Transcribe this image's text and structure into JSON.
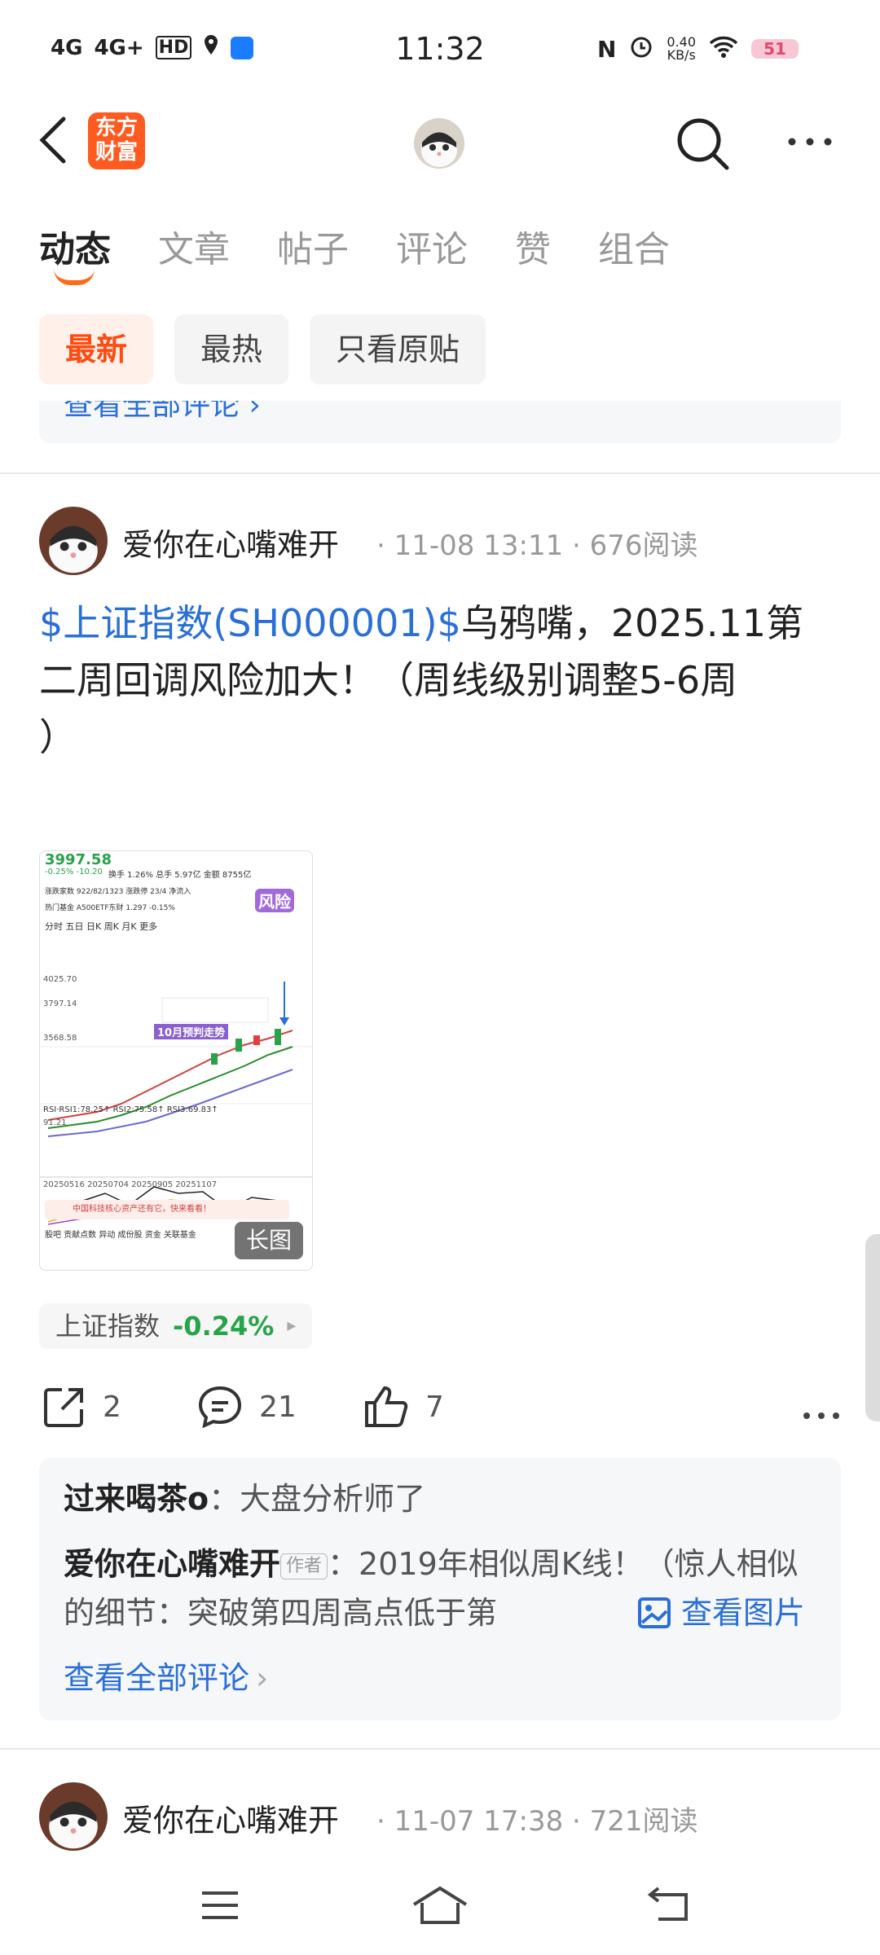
{
  "status_bar": {
    "time": "11:32",
    "signal_1": "4G",
    "signal_2": "4G+",
    "hd": "HD",
    "net_speed": "0.40",
    "net_unit": "KB/s",
    "battery": "51"
  },
  "header": {
    "logo_line1": "东方",
    "logo_line2": "财富"
  },
  "tabs": [
    {
      "label": "动态",
      "active": true
    },
    {
      "label": "文章"
    },
    {
      "label": "帖子"
    },
    {
      "label": "评论"
    },
    {
      "label": "赞"
    },
    {
      "label": "组合"
    }
  ],
  "filters": [
    {
      "label": "最新",
      "active": true
    },
    {
      "label": "最热"
    },
    {
      "label": "只看原贴"
    }
  ],
  "prev_card": {
    "link": "查看全部评论 ›"
  },
  "post": {
    "author": "爱你在心嘴难开",
    "date": "11-08 13:11",
    "reads": "676阅读",
    "stock_link": "$上证指数(SH000001)$",
    "title_text": "乌鸦嘴，2025.11第二周回调风险加大！（周线级别调整5-6周",
    "title_tail": "）",
    "image_badge": "长图",
    "stock_tag_name": "上证指数",
    "stock_tag_change": "-0.24%",
    "share_count": "2",
    "comment_count": "21",
    "like_count": "7",
    "comments": [
      {
        "name": "过来喝茶o",
        "text": "大盘分析师了"
      },
      {
        "name": "爱你在心嘴难开",
        "badge": "作者",
        "text": "2019年相似周K线！（惊人相似的细节：突破第四周高点低于第",
        "link": "查看图片"
      }
    ],
    "view_all": "查看全部评论"
  },
  "next_post": {
    "author": "爱你在心嘴难开",
    "date": "11-07 17:38",
    "reads": "721阅读"
  },
  "thumbnail": {
    "price": "3997.58",
    "change": "-0.25%  -10.20",
    "row1": "换手 1.26%  总手 5.97亿  金额 8755亿",
    "row2": "涨跌家数 922/82/1323  涨跌停 23/4  净流入",
    "row3": "热门基金  A500ETF东财  1.297  -0.15%",
    "periods": "分时  五日  日K  周K  月K  更多",
    "risk": "风险",
    "note": "10月预判走势",
    "y1": "4025.70",
    "y2": "3797.14",
    "y3": "3568.58",
    "rsi": "RSI·RSI1:78.25↑ RSI2:75.58↑ RSI3:69.83↑",
    "rsi_max": "91.21",
    "dates": "20250516  20250704   20250905   20251107",
    "banner": "中国科技核心资产还有它，快来看看！",
    "bottom_tabs": "股吧  贡献点数  异动  成份股  资金  关联基金"
  }
}
